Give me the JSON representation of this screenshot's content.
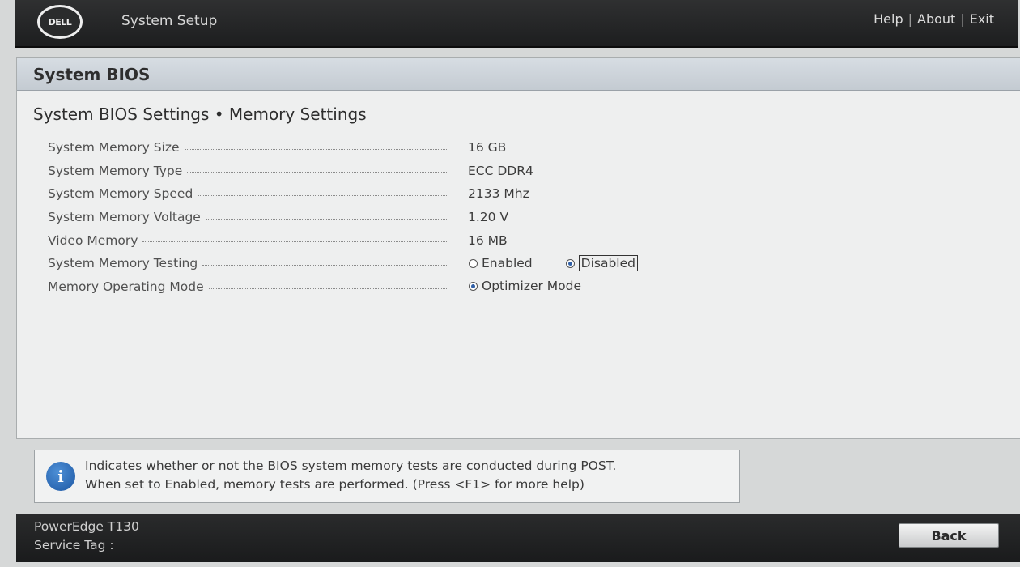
{
  "header": {
    "brand_logo": "DELL",
    "app_title": "System Setup",
    "links": [
      "Help",
      "About",
      "Exit"
    ],
    "separator": "|"
  },
  "panel": {
    "title": "System BIOS",
    "subtitle": "System BIOS Settings • Memory Settings"
  },
  "settings": [
    {
      "label": "System Memory Size",
      "value": "16 GB"
    },
    {
      "label": "System Memory Type",
      "value": "ECC DDR4"
    },
    {
      "label": "System Memory Speed",
      "value": "2133 Mhz"
    },
    {
      "label": "System Memory Voltage",
      "value": "1.20 V"
    },
    {
      "label": "Video Memory",
      "value": "16 MB"
    },
    {
      "label": "System Memory Testing",
      "options": [
        "Enabled",
        "Disabled"
      ],
      "selected": "Disabled"
    },
    {
      "label": "Memory Operating Mode",
      "options": [
        "Optimizer Mode"
      ],
      "selected": "Optimizer Mode"
    }
  ],
  "help": {
    "icon": "info-icon",
    "line1": "Indicates whether or not the BIOS system memory tests are conducted during POST.",
    "line2": "When set to Enabled, memory tests are performed. (Press <F1> for more help)"
  },
  "footer": {
    "model": "PowerEdge T130",
    "service_tag_label": "Service Tag :",
    "back_label": "Back"
  },
  "colors": {
    "header_bg": "#1d1e1f",
    "panel_header_bg": "#c4cbd2",
    "radio_selected": "#2f5fa6",
    "info_icon": "#1d57a3"
  }
}
